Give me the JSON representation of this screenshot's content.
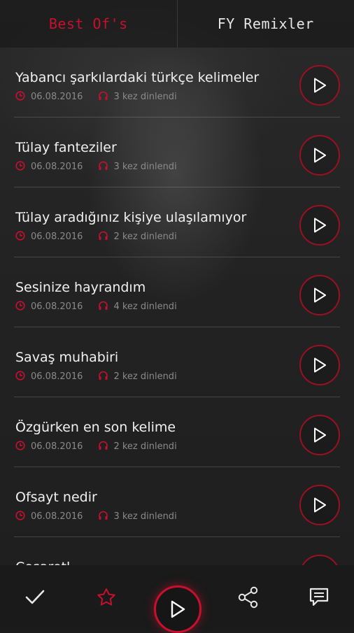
{
  "tabs": [
    {
      "label": "Best Of's",
      "active": true
    },
    {
      "label": "FY Remixler",
      "active": false
    }
  ],
  "items": [
    {
      "title": "Yabancı şarkılardaki türkçe kelimeler",
      "date": "06.08.2016",
      "plays": "3 kez dinlendi"
    },
    {
      "title": "Tülay fanteziler",
      "date": "06.08.2016",
      "plays": "3 kez dinlendi"
    },
    {
      "title": "Tülay aradığınız kişiye ulaşılamıyor",
      "date": "06.08.2016",
      "plays": "2 kez dinlendi"
    },
    {
      "title": "Sesinize hayrandım",
      "date": "06.08.2016",
      "plays": "4 kez dinlendi"
    },
    {
      "title": "Savaş muhabiri",
      "date": "06.08.2016",
      "plays": "2 kez dinlendi"
    },
    {
      "title": "Özgürken en son kelime",
      "date": "06.08.2016",
      "plays": "2 kez dinlendi"
    },
    {
      "title": "Ofsayt nedir",
      "date": "06.08.2016",
      "plays": "3 kez dinlendi"
    },
    {
      "title": "Cesaretl",
      "date": "",
      "plays": ""
    }
  ],
  "bottom_bar": {
    "icons": [
      "check-icon",
      "star-icon",
      "play-icon",
      "share-icon",
      "comment-icon"
    ]
  },
  "colors": {
    "accent": "#c8102e",
    "background": "#1c1c1c",
    "meta_text": "#8a8a8a"
  }
}
